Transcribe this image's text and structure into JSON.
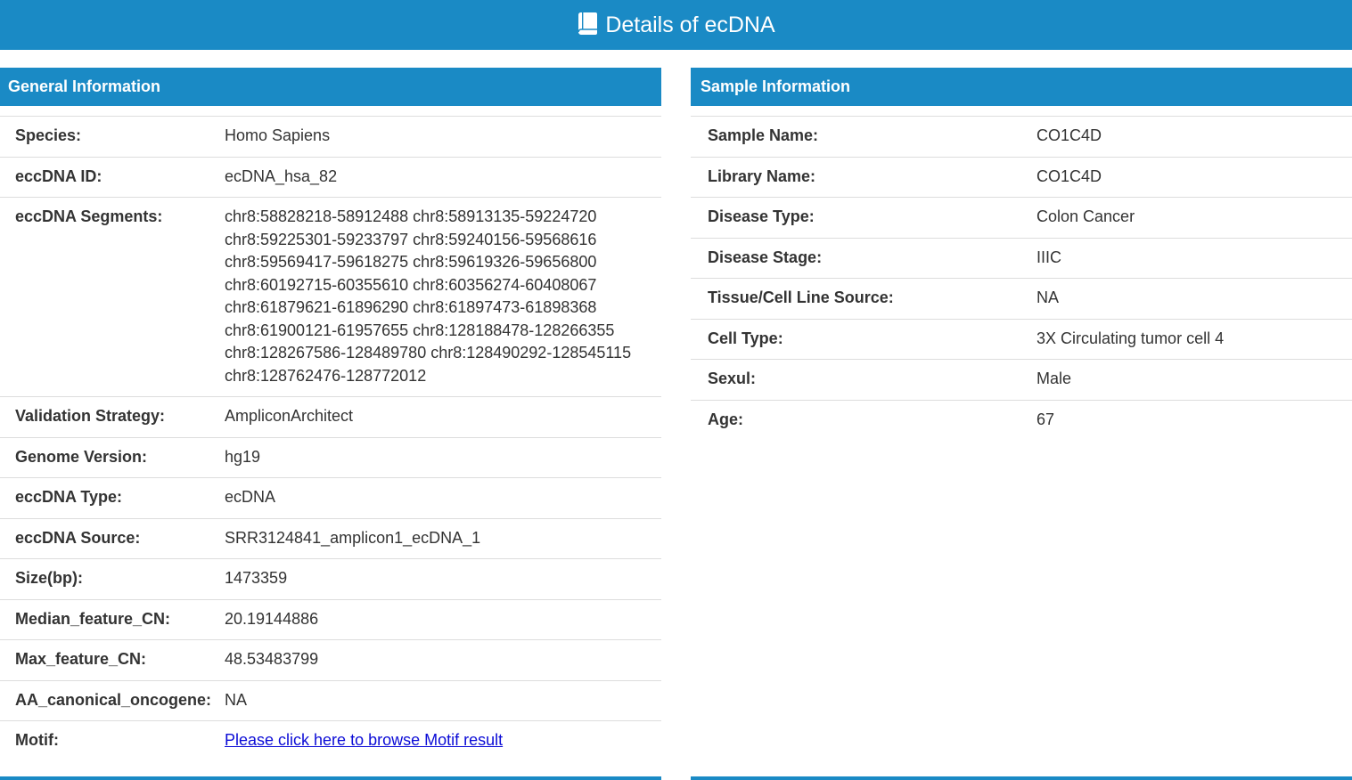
{
  "header": {
    "title": "Details of ecDNA",
    "icon": "book-icon"
  },
  "general": {
    "heading": "General Information",
    "rows": [
      {
        "label": "Species:",
        "value": "Homo Sapiens"
      },
      {
        "label": "eccDNA ID:",
        "value": "ecDNA_hsa_82"
      },
      {
        "label": "eccDNA Segments:",
        "value": "chr8:58828218-58912488 chr8:58913135-59224720 chr8:59225301-59233797 chr8:59240156-59568616 chr8:59569417-59618275 chr8:59619326-59656800 chr8:60192715-60355610 chr8:60356274-60408067 chr8:61879621-61896290 chr8:61897473-61898368 chr8:61900121-61957655 chr8:128188478-128266355 chr8:128267586-128489780 chr8:128490292-128545115 chr8:128762476-128772012"
      },
      {
        "label": "Validation Strategy:",
        "value": "AmpliconArchitect"
      },
      {
        "label": "Genome Version:",
        "value": "hg19"
      },
      {
        "label": "eccDNA Type:",
        "value": "ecDNA"
      },
      {
        "label": "eccDNA Source:",
        "value": "SRR3124841_amplicon1_ecDNA_1"
      },
      {
        "label": "Size(bp):",
        "value": "1473359"
      },
      {
        "label": "Median_feature_CN:",
        "value": "20.19144886"
      },
      {
        "label": "Max_feature_CN:",
        "value": "48.53483799"
      },
      {
        "label": "AA_canonical_oncogene:",
        "value": "NA"
      },
      {
        "label": "Motif:",
        "value": "Please click here to browse Motif result"
      }
    ]
  },
  "sample": {
    "heading": "Sample Information",
    "rows": [
      {
        "label": "Sample Name:",
        "value": "CO1C4D"
      },
      {
        "label": "Library Name:",
        "value": "CO1C4D"
      },
      {
        "label": "Disease Type:",
        "value": "Colon Cancer"
      },
      {
        "label": "Disease Stage:",
        "value": "IIIC"
      },
      {
        "label": "Tissue/Cell Line Source:",
        "value": "NA"
      },
      {
        "label": "Cell Type:",
        "value": "3X Circulating tumor cell 4"
      },
      {
        "label": "Sexul:",
        "value": "Male"
      },
      {
        "label": "Age:",
        "value": "67"
      }
    ]
  },
  "colors": {
    "primary": "#1a8ac5",
    "link": "#0b0bd6",
    "border": "#dddddd",
    "text": "#333333"
  }
}
